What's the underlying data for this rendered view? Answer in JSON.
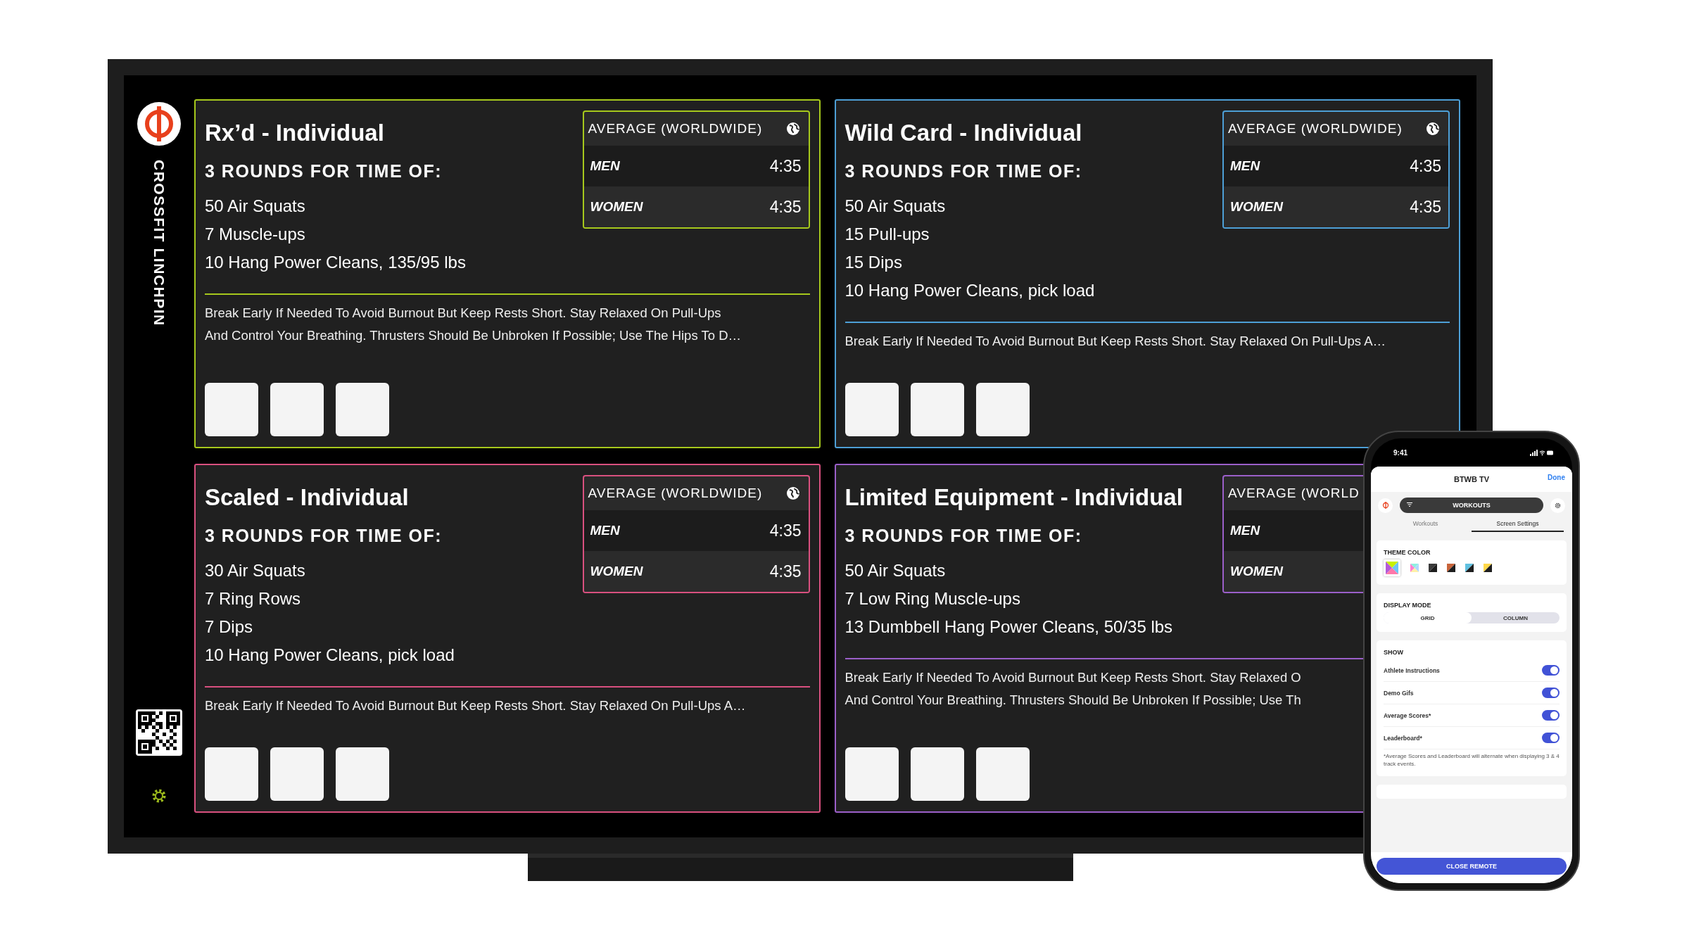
{
  "brand": {
    "name": "CROSSFIT LINCHPIN"
  },
  "cards": [
    {
      "title": "Rx’d - Individual",
      "color": "#a6c81c",
      "subtitle": "3 ROUNDS FOR TIME OF:",
      "movements": [
        "50 Air Squats",
        "7 Muscle-ups",
        "10 Hang Power Cleans, 135/95 lbs"
      ],
      "average": {
        "title": "AVERAGE (WORLDWIDE)",
        "globe_icon": true,
        "rows": [
          {
            "label": "MEN",
            "time": "4:35"
          },
          {
            "label": "WOMEN",
            "time": "4:35"
          }
        ]
      },
      "description": [
        "Break Early If Needed To Avoid Burnout But Keep Rests Short. Stay Relaxed On Pull-Ups",
        "And Control Your Breathing. Thrusters Should Be Unbroken If Possible; Use The Hips To D…"
      ],
      "demos": [
        {
          "kind": "photo"
        },
        {
          "kind": "photo"
        },
        {
          "kind": "photo"
        }
      ]
    },
    {
      "title": "Wild Card - Individual",
      "color": "#4d9fd6",
      "subtitle": "3 ROUNDS FOR TIME OF:",
      "movements": [
        "50 Air Squats",
        "15 Pull-ups",
        "15 Dips",
        "10 Hang Power Cleans, pick load"
      ],
      "average": {
        "title": "AVERAGE (WORLDWIDE)",
        "globe_icon": true,
        "rows": [
          {
            "label": "MEN",
            "time": "4:35"
          },
          {
            "label": "WOMEN",
            "time": "4:35"
          }
        ]
      },
      "description": [
        "Break Early If Needed To Avoid Burnout But Keep Rests Short. Stay Relaxed On Pull-Ups A…"
      ],
      "demos": [
        {
          "kind": "photo"
        },
        {
          "kind": "photo"
        },
        {
          "kind": "photo"
        }
      ]
    },
    {
      "title": "Scaled - Individual",
      "color": "#d9507f",
      "subtitle": "3 ROUNDS FOR TIME OF:",
      "movements": [
        "30 Air Squats",
        "7 Ring Rows",
        "7 Dips",
        "10 Hang Power Cleans, pick load"
      ],
      "average": {
        "title": "AVERAGE (WORLDWIDE)",
        "globe_icon": true,
        "rows": [
          {
            "label": "MEN",
            "time": "4:35"
          },
          {
            "label": "WOMEN",
            "time": "4:35"
          }
        ]
      },
      "description": [
        "Break Early If Needed To Avoid Burnout But Keep Rests Short. Stay Relaxed On Pull-Ups A…"
      ],
      "demos": [
        {
          "kind": "photo"
        },
        {
          "kind": "photo"
        },
        {
          "kind": "photo"
        }
      ]
    },
    {
      "title": "Limited Equipment - Individual",
      "color": "#9b5fc9",
      "subtitle": "3 ROUNDS FOR TIME OF:",
      "movements": [
        "50 Air Squats",
        "7 Low Ring Muscle-ups",
        "13 Dumbbell Hang Power Cleans, 50/35 lbs"
      ],
      "average": {
        "title": "AVERAGE (WORLD",
        "rows": [
          {
            "label": "MEN"
          },
          {
            "label": "WOMEN"
          }
        ]
      },
      "description": [
        "Break Early If Needed To Avoid Burnout But Keep Rests Short. Stay Relaxed O",
        "And Control Your Breathing. Thrusters Should Be Unbroken If Possible; Use Th"
      ],
      "demos": [
        {
          "kind": "photo"
        },
        {
          "kind": "photo"
        },
        {
          "kind": "photo"
        }
      ]
    }
  ],
  "remote": {
    "status_time": "9:41",
    "title": "BTWB TV",
    "done": "Done",
    "menu": "WORKOUTS",
    "tabs": [
      {
        "label": "Workouts",
        "selected": false
      },
      {
        "label": "Screen Settings",
        "selected": true
      }
    ],
    "theme": {
      "heading": "THEME COLOR",
      "swatches": [
        {
          "kind": "vivid",
          "selected": true
        },
        {
          "kind": "pastel",
          "selected": false
        },
        {
          "kind": "split",
          "selected": false,
          "color": "#3a3a3a"
        },
        {
          "kind": "split",
          "selected": false,
          "color": "#c8643a"
        },
        {
          "kind": "split",
          "selected": false,
          "color": "#60c0e0"
        },
        {
          "kind": "split",
          "selected": false,
          "color": "#ffd84a"
        }
      ]
    },
    "display_mode": {
      "heading": "DISPLAY MODE",
      "options": [
        {
          "label": "GRID",
          "selected": true
        },
        {
          "label": "COLUMN",
          "selected": false
        }
      ]
    },
    "show": {
      "heading": "SHOW",
      "items": [
        {
          "label": "Athlete Instructions",
          "on": true
        },
        {
          "label": "Demo Gifs",
          "on": true
        },
        {
          "label": "Average Scores*",
          "on": true
        },
        {
          "label": "Leaderboard*",
          "on": true
        }
      ],
      "note": "*Average Scores and Leaderboard will alternate when displaying 3 & 4 track events."
    },
    "close": "CLOSE REMOTE"
  }
}
